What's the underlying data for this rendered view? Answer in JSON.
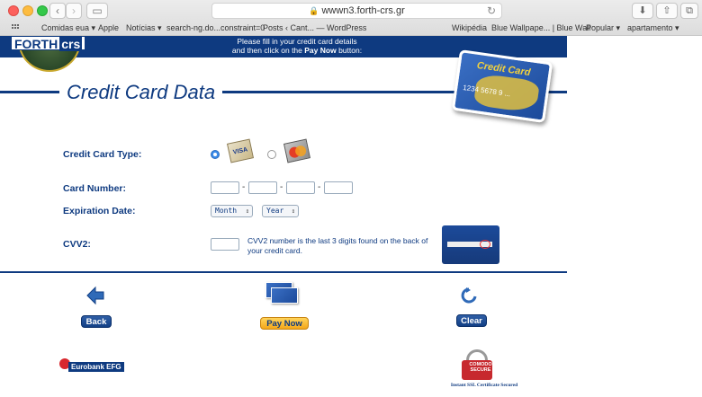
{
  "browser": {
    "url": "wwwn3.forth-crs.gr",
    "bookmarks": [
      "Comidas eua ▾",
      "Apple",
      "Notícias ▾",
      "search-ng.do...constraint=0",
      "Posts ‹ Cant... — WordPress",
      "Wikipédia",
      "Blue Wallpape... | Blue Wall",
      "Popular ▾",
      "apartamento ▾"
    ]
  },
  "header": {
    "logo_text": "FORTH",
    "logo_text_accent": "crs",
    "message_line1": "Please fill in your credit card details",
    "message_line2_prefix": "and then click on the ",
    "message_line2_bold": "Pay Now",
    "message_line2_suffix": " button:"
  },
  "title": "Credit Card Data",
  "big_card": {
    "label": "Credit Card",
    "digits": "1234  5678  9 ..."
  },
  "form": {
    "card_type_label": "Credit Card Type:",
    "visa_text": "VISA",
    "card_number_label": "Card Number:",
    "expiration_label": "Expiration Date:",
    "month_option": "Month",
    "year_option": "Year",
    "cvv_label": "CVV2:",
    "cvv_help": "CVV2 number is the last 3 digits found on the back of your credit card."
  },
  "actions": {
    "back": "Back",
    "pay": "Pay Now",
    "clear": "Clear"
  },
  "footer": {
    "bank": "Eurobank EFG",
    "ssl_brand": "COMODO SECURE",
    "ssl_caption": "Instant SSL Certificate Secured"
  }
}
